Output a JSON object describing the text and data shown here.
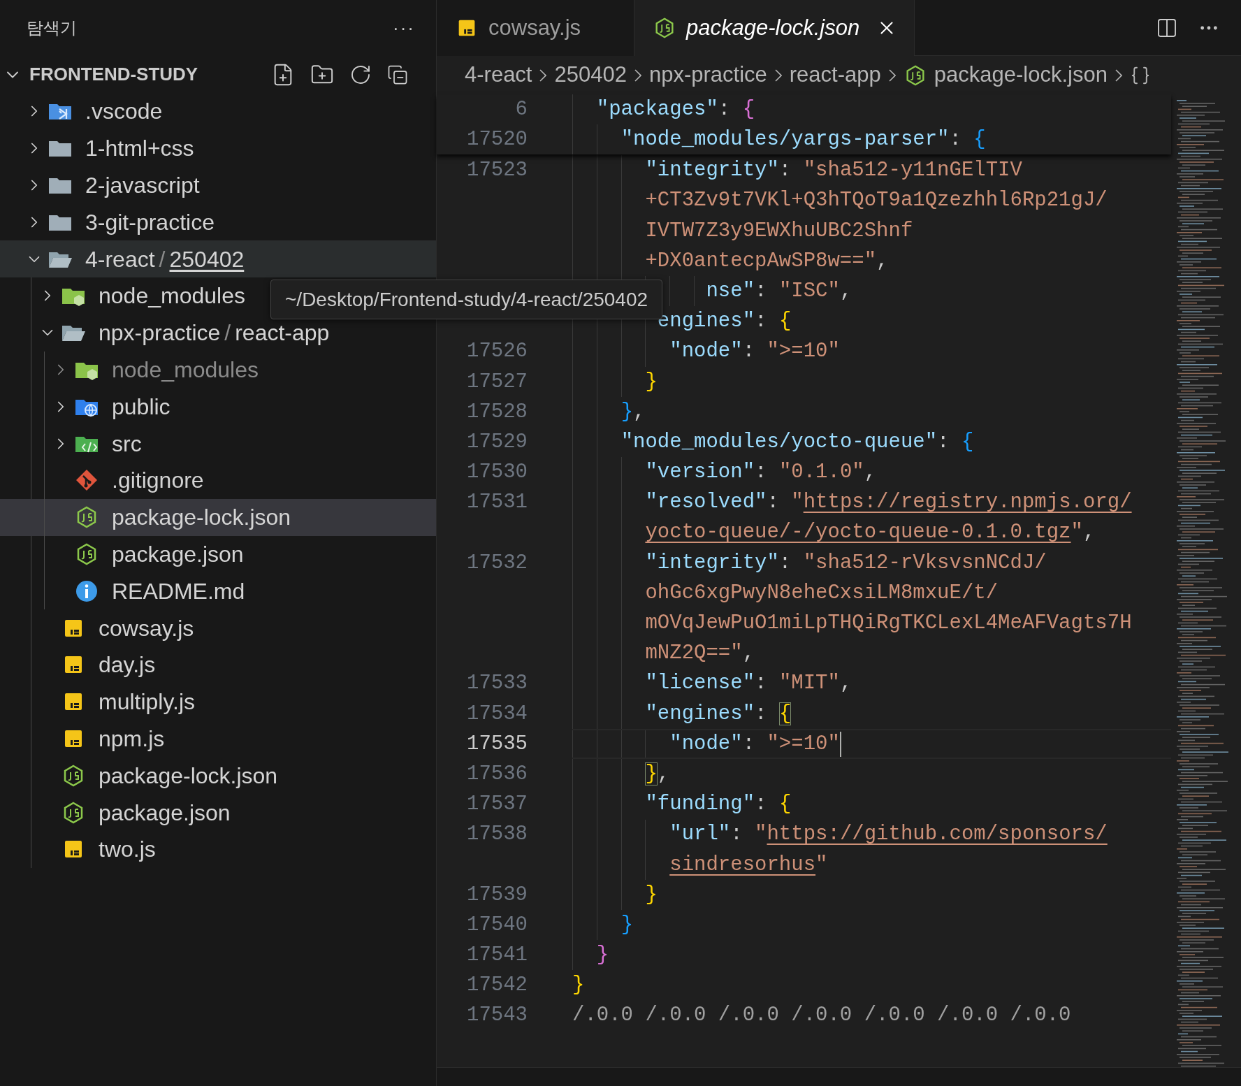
{
  "explorer": {
    "title": "탐색기",
    "more": "···",
    "workspace": {
      "name": "FRONTEND-STUDY",
      "expanded": true
    },
    "tree": [
      {
        "label": ".vscode",
        "kind": "vscode-folder",
        "expanded": false,
        "selected": false,
        "hovered": false,
        "ignored": false
      },
      {
        "label": "1-html+css",
        "kind": "folder",
        "expanded": false,
        "selected": false,
        "hovered": false,
        "ignored": false
      },
      {
        "label": "2-javascript",
        "kind": "folder",
        "expanded": false,
        "selected": false,
        "hovered": false,
        "ignored": false
      },
      {
        "label": "3-git-practice",
        "kind": "folder",
        "expanded": false,
        "selected": false,
        "hovered": false,
        "ignored": false
      },
      {
        "segments": [
          {
            "text": "4-react",
            "hovered": false
          },
          {
            "text": "250402",
            "hovered": true
          }
        ],
        "separator": "/",
        "kind": "folder",
        "expanded": true,
        "selected": false,
        "hovered": true,
        "ignored": false,
        "children": [
          {
            "label": "node_modules",
            "kind": "node-folder",
            "expanded": false,
            "selected": false,
            "hovered": false,
            "ignored": false
          },
          {
            "segments": [
              {
                "text": "npx-practice",
                "hovered": false
              },
              {
                "text": "react-app",
                "hovered": false
              }
            ],
            "separator": "/",
            "kind": "folder",
            "expanded": true,
            "selected": false,
            "hovered": false,
            "ignored": false,
            "children": [
              {
                "label": "node_modules",
                "kind": "node-folder",
                "expanded": false,
                "selected": false,
                "hovered": false,
                "ignored": true
              },
              {
                "label": "public",
                "kind": "public-folder",
                "expanded": false,
                "selected": false,
                "hovered": false,
                "ignored": false
              },
              {
                "label": "src",
                "kind": "src-folder",
                "expanded": false,
                "selected": false,
                "hovered": false,
                "ignored": false
              },
              {
                "label": ".gitignore",
                "kind": "git",
                "selected": false,
                "hovered": false,
                "ignored": false
              },
              {
                "label": "package-lock.json",
                "kind": "node-json",
                "selected": true,
                "hovered": false,
                "ignored": false
              },
              {
                "label": "package.json",
                "kind": "node-json",
                "selected": false,
                "hovered": false,
                "ignored": false
              },
              {
                "label": "README.md",
                "kind": "info",
                "selected": false,
                "hovered": false,
                "ignored": false
              }
            ]
          },
          {
            "label": "cowsay.js",
            "kind": "js",
            "selected": false,
            "hovered": false,
            "ignored": false
          },
          {
            "label": "day.js",
            "kind": "js",
            "selected": false,
            "hovered": false,
            "ignored": false
          },
          {
            "label": "multiply.js",
            "kind": "js",
            "selected": false,
            "hovered": false,
            "ignored": false
          },
          {
            "label": "npm.js",
            "kind": "js",
            "selected": false,
            "hovered": false,
            "ignored": false
          },
          {
            "label": "package-lock.json",
            "kind": "node-json",
            "selected": false,
            "hovered": false,
            "ignored": false
          },
          {
            "label": "package.json",
            "kind": "node-json",
            "selected": false,
            "hovered": false,
            "ignored": false
          },
          {
            "label": "two.js",
            "kind": "js",
            "selected": false,
            "hovered": false,
            "ignored": false
          }
        ]
      }
    ]
  },
  "tooltip": {
    "text": "~/Desktop/Frontend-study/4-react/250402"
  },
  "tabs": [
    {
      "label": "cowsay.js",
      "kind": "js",
      "selected": false,
      "preview": false
    },
    {
      "label": "package-lock.json",
      "kind": "node-json",
      "selected": true,
      "preview": true
    }
  ],
  "breadcrumb": [
    {
      "text": "4-react",
      "kind": "folder"
    },
    {
      "text": "250402",
      "kind": "folder"
    },
    {
      "text": "npx-practice",
      "kind": "folder"
    },
    {
      "text": "react-app",
      "kind": "folder"
    },
    {
      "text": "package-lock.json",
      "kind": "node-json"
    }
  ],
  "sticky_lines": [
    {
      "number": "6",
      "current": false,
      "tokens": [
        {
          "kind": "key",
          "text": "  \"packages\""
        },
        {
          "kind": "punct",
          "text": ": "
        },
        {
          "kind": "brace",
          "text": "{",
          "color": "#da70d6",
          "matched": false
        }
      ]
    },
    {
      "number": "17520",
      "current": false,
      "tokens": [
        {
          "kind": "key",
          "text": "    \"node_modules/yargs-parser\""
        },
        {
          "kind": "punct",
          "text": ": "
        },
        {
          "kind": "brace",
          "text": "{",
          "color": "#179fff",
          "matched": false
        }
      ]
    }
  ],
  "lines": [
    {
      "number": "17523",
      "current": false,
      "tokens": [
        {
          "kind": "key",
          "text": "      \"integrity\""
        },
        {
          "kind": "punct",
          "text": ": "
        },
        {
          "kind": "str",
          "text": "\"sha512-y11nGElTIV"
        }
      ]
    },
    {
      "current": false,
      "tokens": [
        {
          "kind": "str",
          "text": "      +CT3Zv9t7VKl+Q3hTQoT9a1Qzezhhl6Rp21gJ/"
        }
      ]
    },
    {
      "current": false,
      "tokens": [
        {
          "kind": "str",
          "text": "      IVTW7Z3y9EWXhuUBC2Shnf"
        }
      ]
    },
    {
      "current": false,
      "tokens": [
        {
          "kind": "str",
          "text": "      +DX0antecpAwSP8w==\""
        },
        {
          "kind": "punct",
          "text": ","
        }
      ]
    },
    {
      "current": false,
      "tokens": [
        {
          "kind": "key",
          "text": "           nse\""
        },
        {
          "kind": "punct",
          "text": ": "
        },
        {
          "kind": "str",
          "text": "\"ISC\""
        },
        {
          "kind": "punct",
          "text": ","
        }
      ]
    },
    {
      "current": false,
      "tokens": [
        {
          "kind": "key",
          "text": "       engines\""
        },
        {
          "kind": "punct",
          "text": ": "
        },
        {
          "kind": "brace",
          "text": "{",
          "color": "#ffd700",
          "matched": false
        }
      ]
    },
    {
      "number": "17526",
      "current": false,
      "tokens": [
        {
          "kind": "key",
          "text": "        \"node\""
        },
        {
          "kind": "punct",
          "text": ": "
        },
        {
          "kind": "str",
          "text": "\">=10\""
        }
      ]
    },
    {
      "number": "17527",
      "current": false,
      "tokens": [
        {
          "kind": "brace",
          "text": "      }",
          "color": "#ffd700",
          "matched": false
        }
      ]
    },
    {
      "number": "17528",
      "current": false,
      "tokens": [
        {
          "kind": "brace",
          "text": "    }",
          "color": "#179fff",
          "matched": false
        },
        {
          "kind": "punct",
          "text": ","
        }
      ]
    },
    {
      "number": "17529",
      "current": false,
      "tokens": [
        {
          "kind": "key",
          "text": "    \"node_modules/yocto-queue\""
        },
        {
          "kind": "punct",
          "text": ": "
        },
        {
          "kind": "brace",
          "text": "{",
          "color": "#179fff",
          "matched": false
        }
      ]
    },
    {
      "number": "17530",
      "current": false,
      "tokens": [
        {
          "kind": "key",
          "text": "      \"version\""
        },
        {
          "kind": "punct",
          "text": ": "
        },
        {
          "kind": "str",
          "text": "\"0.1.0\""
        },
        {
          "kind": "punct",
          "text": ","
        }
      ]
    },
    {
      "number": "17531",
      "current": false,
      "tokens": [
        {
          "kind": "key",
          "text": "      \"resolved\""
        },
        {
          "kind": "punct",
          "text": ": "
        },
        {
          "kind": "str",
          "text": "\""
        },
        {
          "kind": "link",
          "text": "https://registry.npmjs.org/"
        }
      ]
    },
    {
      "current": false,
      "tokens": [
        {
          "kind": "link",
          "text": "      yocto-queue/-/yocto-queue-0.1.0.tgz"
        },
        {
          "kind": "str",
          "text": "\""
        },
        {
          "kind": "punct",
          "text": ","
        }
      ]
    },
    {
      "number": "17532",
      "current": false,
      "tokens": [
        {
          "kind": "key",
          "text": "      \"integrity\""
        },
        {
          "kind": "punct",
          "text": ": "
        },
        {
          "kind": "str",
          "text": "\"sha512-rVksvsnNCdJ/"
        }
      ]
    },
    {
      "current": false,
      "tokens": [
        {
          "kind": "str",
          "text": "      ohGc6xgPwyN8eheCxsiLM8mxuE/t/"
        }
      ]
    },
    {
      "current": false,
      "tokens": [
        {
          "kind": "str",
          "text": "      mOVqJewPuO1miLpTHQiRgTKCLexL4MeAFVagts7H"
        }
      ]
    },
    {
      "current": false,
      "tokens": [
        {
          "kind": "str",
          "text": "      mNZ2Q==\""
        },
        {
          "kind": "punct",
          "text": ","
        }
      ]
    },
    {
      "number": "17533",
      "current": false,
      "tokens": [
        {
          "kind": "key",
          "text": "      \"license\""
        },
        {
          "kind": "punct",
          "text": ": "
        },
        {
          "kind": "str",
          "text": "\"MIT\""
        },
        {
          "kind": "punct",
          "text": ","
        }
      ]
    },
    {
      "number": "17534",
      "current": false,
      "tokens": [
        {
          "kind": "key",
          "text": "      \"engines\""
        },
        {
          "kind": "punct",
          "text": ": "
        },
        {
          "kind": "brace",
          "text": "{",
          "color": "#ffd700",
          "matched": true
        }
      ]
    },
    {
      "number": "17535",
      "current": true,
      "tokens": [
        {
          "kind": "key",
          "text": "        \"node\""
        },
        {
          "kind": "punct",
          "text": ": "
        },
        {
          "kind": "str",
          "text": "\">=10\""
        }
      ]
    },
    {
      "number": "17536",
      "current": false,
      "tokens": [
        {
          "kind": "brace",
          "text": "      }",
          "color": "#ffd700",
          "matched": true
        },
        {
          "kind": "punct",
          "text": ","
        }
      ]
    },
    {
      "number": "17537",
      "current": false,
      "tokens": [
        {
          "kind": "key",
          "text": "      \"funding\""
        },
        {
          "kind": "punct",
          "text": ": "
        },
        {
          "kind": "brace",
          "text": "{",
          "color": "#ffd700",
          "matched": false
        }
      ]
    },
    {
      "number": "17538",
      "current": false,
      "tokens": [
        {
          "kind": "key",
          "text": "        \"url\""
        },
        {
          "kind": "punct",
          "text": ": "
        },
        {
          "kind": "str",
          "text": "\""
        },
        {
          "kind": "link",
          "text": "https://github.com/sponsors/"
        }
      ]
    },
    {
      "current": false,
      "tokens": [
        {
          "kind": "link",
          "text": "        sindresorhus"
        },
        {
          "kind": "str",
          "text": "\""
        }
      ]
    },
    {
      "number": "17539",
      "current": false,
      "tokens": [
        {
          "kind": "brace",
          "text": "      }",
          "color": "#ffd700",
          "matched": false
        }
      ]
    },
    {
      "number": "17540",
      "current": false,
      "tokens": [
        {
          "kind": "brace",
          "text": "    }",
          "color": "#179fff",
          "matched": false
        }
      ]
    },
    {
      "number": "17541",
      "current": false,
      "tokens": [
        {
          "kind": "brace",
          "text": "  }",
          "color": "#da70d6",
          "matched": false
        }
      ]
    },
    {
      "number": "17542",
      "current": false,
      "tokens": [
        {
          "kind": "brace",
          "text": "}",
          "color": "#ffd700",
          "matched": false
        }
      ]
    },
    {
      "number": "17543",
      "current": false,
      "tokens": [
        {
          "kind": "dim",
          "text": "/.0.0 /.0.0 /.0.0 /.0.0 /.0.0 /.0.0 /.0.0"
        }
      ]
    }
  ]
}
